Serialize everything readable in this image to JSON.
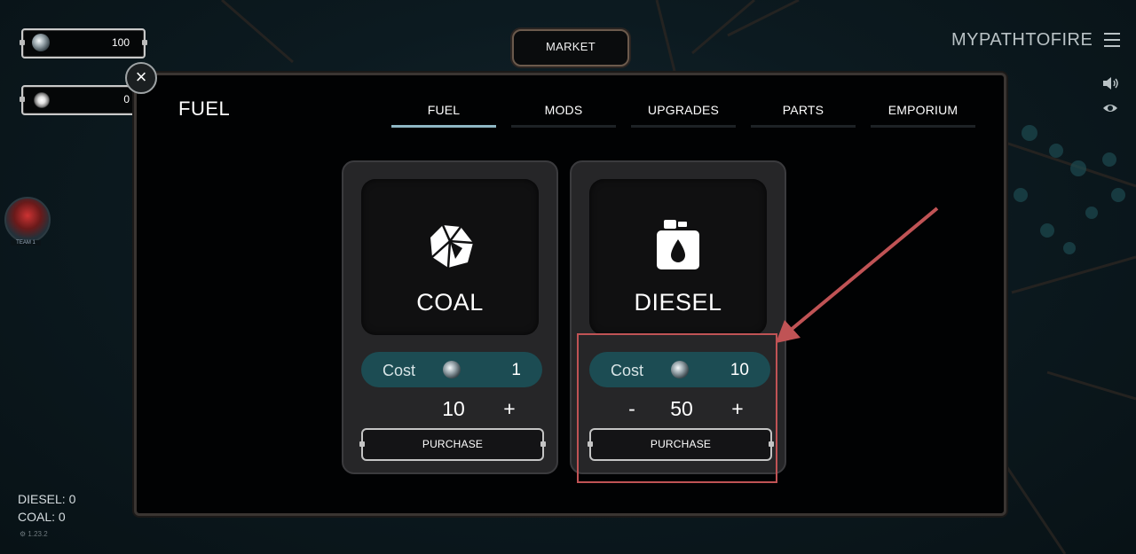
{
  "resources": [
    {
      "icon": "silver-coin-icon",
      "value": "100"
    },
    {
      "icon": "spark-icon",
      "value": "0"
    }
  ],
  "market_tab": {
    "label": "MARKET"
  },
  "brand": {
    "name": "MYPATHTOFIRE"
  },
  "avatar": {
    "label": "TEAM 1"
  },
  "panel": {
    "title": "FUEL",
    "tabs": [
      {
        "label": "FUEL",
        "active": true
      },
      {
        "label": "MODS",
        "active": false
      },
      {
        "label": "UPGRADES",
        "active": false
      },
      {
        "label": "PARTS",
        "active": false
      },
      {
        "label": "EMPORIUM",
        "active": false
      }
    ]
  },
  "cards": [
    {
      "name": "COAL",
      "icon": "coal-icon",
      "cost_label": "Cost",
      "cost": "1",
      "quantity": "10",
      "plus": "+",
      "minus": "",
      "purchase_label": "PURCHASE"
    },
    {
      "name": "DIESEL",
      "icon": "fuel-can-icon",
      "cost_label": "Cost",
      "cost": "10",
      "quantity": "50",
      "plus": "+",
      "minus": "-",
      "purchase_label": "PURCHASE"
    }
  ],
  "status": {
    "diesel": "DIESEL: 0",
    "coal": "COAL: 0"
  },
  "version": "1.23.2",
  "colors": {
    "accent": "#8fb7c4",
    "cost_pill": "#1c4c53",
    "highlight": "#c05355"
  }
}
